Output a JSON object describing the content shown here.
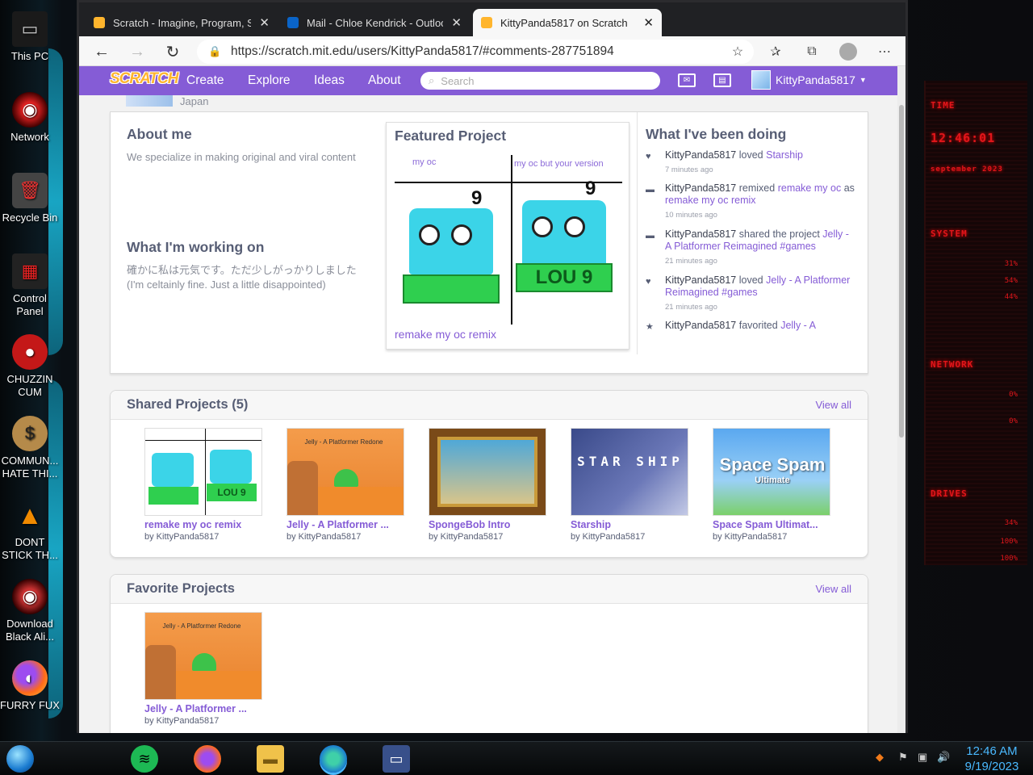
{
  "desktop": {
    "icons": [
      {
        "label": "This PC"
      },
      {
        "label": "Network"
      },
      {
        "label": "Recycle Bin"
      },
      {
        "label": "Control Panel"
      },
      {
        "label": "CHUZZIN CUM"
      },
      {
        "label": "COMMUN... HATE THI..."
      },
      {
        "label": "DONT STICK TH..."
      },
      {
        "label": "Download Black Ali..."
      },
      {
        "label": "FURRY FUX"
      }
    ],
    "widget": {
      "time_label": "TIME",
      "time_value": "12:46:01",
      "date_value": "september 2023",
      "system_label": "SYSTEM",
      "sys_vals": [
        "31%",
        "54%",
        "44%"
      ],
      "network_label": "NETWORK",
      "net_vals": [
        "0%",
        "0%"
      ],
      "drives_label": "DRIVES",
      "drive_vals": [
        "34%",
        "100%",
        "100%"
      ]
    }
  },
  "browser": {
    "tabs": [
      {
        "title": "Scratch - Imagine, Program, Sha",
        "icon": "scratch-favicon"
      },
      {
        "title": "Mail - Chloe Kendrick - Outlook",
        "icon": "outlook-favicon"
      },
      {
        "title": "KittyPanda5817 on Scratch",
        "icon": "scratch-favicon",
        "active": true
      }
    ],
    "url": "https://scratch.mit.edu/users/KittyPanda5817/#comments-287751894"
  },
  "scratch_nav": {
    "logo": "SCRATCH",
    "links": [
      "Create",
      "Explore",
      "Ideas",
      "About"
    ],
    "search_placeholder": "Search",
    "username": "KittyPanda5817"
  },
  "profile": {
    "location": "Japan",
    "about_me_title": "About me",
    "about_me_text": "We specialize in making original and viral content",
    "working_on_title": "What I'm working on",
    "working_on_text_1": "確かに私は元気です。ただ少しがっかりしました",
    "working_on_text_2": "(I'm celtainly fine. Just a little disappointed)",
    "featured_title": "Featured Project",
    "featured_name": "remake my oc remix",
    "featured_thumb_left": "my oc",
    "featured_thumb_right": "my oc but your version",
    "activity_title": "What I've been doing",
    "activity": [
      {
        "icon": "heart-icon",
        "user": "KittyPanda5817",
        "verb": "loved",
        "target": "Starship",
        "ago": "7 minutes ago"
      },
      {
        "icon": "remix-icon",
        "user": "KittyPanda5817",
        "verb": "remixed",
        "target": "remake my oc",
        "extra": "as",
        "target2": "remake my oc remix",
        "ago": "10 minutes ago"
      },
      {
        "icon": "share-icon",
        "user": "KittyPanda5817",
        "verb": "shared the project",
        "target": "Jelly - A Platformer Reimagined #games",
        "ago": "21 minutes ago"
      },
      {
        "icon": "heart-icon",
        "user": "KittyPanda5817",
        "verb": "loved",
        "target": "Jelly - A Platformer Reimagined #games",
        "ago": "21 minutes ago"
      },
      {
        "icon": "star-icon",
        "user": "KittyPanda5817",
        "verb": "favorited",
        "target": "Jelly - A",
        "ago": ""
      }
    ]
  },
  "shared": {
    "title": "Shared Projects (5)",
    "view_all": "View all",
    "projects": [
      {
        "title": "remake my oc remix",
        "by": "by KittyPanda5817"
      },
      {
        "title": "Jelly - A Platformer ...",
        "by": "by KittyPanda5817",
        "thumb_text": "Jelly - A Platformer Redone"
      },
      {
        "title": "SpongeBob Intro",
        "by": "by KittyPanda5817"
      },
      {
        "title": "Starship",
        "by": "by KittyPanda5817",
        "thumb_text": "STAR SHIP"
      },
      {
        "title": "Space Spam Ultimat...",
        "by": "by KittyPanda5817",
        "thumb_text": "Space Spam",
        "thumb_sub": "Ultimate"
      }
    ]
  },
  "favorites": {
    "title": "Favorite Projects",
    "view_all": "View all",
    "projects": [
      {
        "title": "Jelly - A Platformer ...",
        "by": "by KittyPanda5817",
        "thumb_text": "Jelly - A Platformer Redone"
      }
    ]
  },
  "taskbar": {
    "time": "12:46 AM",
    "date": "9/19/2023"
  },
  "colors": {
    "scratch_purple": "#855cd6",
    "text_gray": "#575e75",
    "clock_blue": "#4ab9ff",
    "widget_red": "#e0161b"
  }
}
